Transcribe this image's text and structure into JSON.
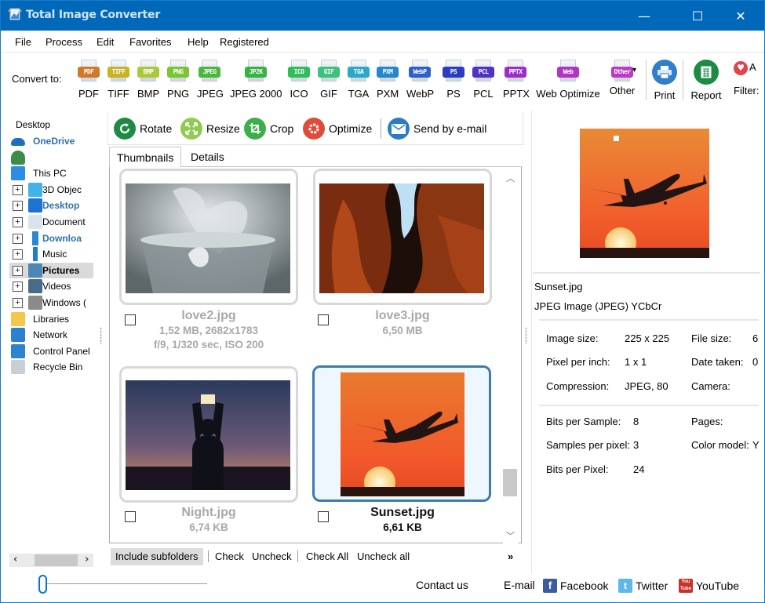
{
  "window": {
    "title": "Total Image Converter",
    "controls": {
      "minimize": "—",
      "maximize": "☐",
      "close": "✕"
    }
  },
  "menu": [
    "File",
    "Process",
    "Edit",
    "Favorites",
    "Help",
    "Registered"
  ],
  "toolbar": {
    "convert_label": "Convert to:",
    "formats": [
      {
        "badge": "PDF",
        "label": "PDF",
        "color": "#d2782a"
      },
      {
        "badge": "TIFF",
        "label": "TIFF",
        "color": "#c9b322"
      },
      {
        "badge": "BMP",
        "label": "BMP",
        "color": "#a9c83a"
      },
      {
        "badge": "PNG",
        "label": "PNG",
        "color": "#79c536"
      },
      {
        "badge": "JPEG",
        "label": "JPEG",
        "color": "#4bb73a"
      },
      {
        "badge": "JP2K",
        "label": "JPEG 2000",
        "color": "#36b341"
      },
      {
        "badge": "ICO",
        "label": "ICO",
        "color": "#2fbd5a"
      },
      {
        "badge": "GIF",
        "label": "GIF",
        "color": "#3ac27e"
      },
      {
        "badge": "TGA",
        "label": "TGA",
        "color": "#2aa8c6"
      },
      {
        "badge": "PXM",
        "label": "PXM",
        "color": "#2386cf"
      },
      {
        "badge": "WebP",
        "label": "WebP",
        "color": "#2f5fc7"
      },
      {
        "badge": "PS",
        "label": "PS",
        "color": "#2b3bc2"
      },
      {
        "badge": "PCL",
        "label": "PCL",
        "color": "#4f33c4"
      },
      {
        "badge": "PPTX",
        "label": "PPTX",
        "color": "#9b2fc6"
      },
      {
        "badge": "Web",
        "label": "Web Optimize",
        "color": "#b035c2"
      },
      {
        "badge": "Other",
        "label": "Other",
        "color": "#b93cc4"
      }
    ],
    "print_label": "Print",
    "report_label": "Report",
    "filter_label": "Filter:",
    "favorite_label": "A"
  },
  "tree": {
    "root": "Desktop",
    "items": [
      {
        "label": "OneDrive",
        "icon": "onedrive-icon",
        "style": "blue"
      },
      {
        "label": "",
        "icon": "user-icon",
        "style": "normal"
      },
      {
        "label": "This PC",
        "icon": "computer-icon",
        "style": "normal"
      },
      {
        "label": "3D Objec",
        "icon": "3d-objects-icon",
        "style": "normal",
        "expandable": true
      },
      {
        "label": "Desktop",
        "icon": "desktop-icon",
        "style": "blue",
        "expandable": true
      },
      {
        "label": "Document",
        "icon": "documents-icon",
        "style": "normal",
        "expandable": true
      },
      {
        "label": "Downloa",
        "icon": "downloads-icon",
        "style": "blue",
        "expandable": true
      },
      {
        "label": "Music",
        "icon": "music-icon",
        "style": "normal",
        "expandable": true
      },
      {
        "label": "Pictures",
        "icon": "pictures-icon",
        "style": "bold",
        "expandable": true,
        "selected": true
      },
      {
        "label": "Videos",
        "icon": "videos-icon",
        "style": "normal",
        "expandable": true
      },
      {
        "label": "Windows (",
        "icon": "drive-icon",
        "style": "normal",
        "expandable": true
      },
      {
        "label": "Libraries",
        "icon": "libraries-icon",
        "style": "normal"
      },
      {
        "label": "Network",
        "icon": "network-icon",
        "style": "normal"
      },
      {
        "label": "Control Panel",
        "icon": "control-panel-icon",
        "style": "normal"
      },
      {
        "label": "Recycle Bin",
        "icon": "recycle-bin-icon",
        "style": "normal"
      }
    ]
  },
  "actions": {
    "rotate": "Rotate",
    "resize": "Resize",
    "crop": "Crop",
    "optimize": "Optimize",
    "send_email": "Send by e-mail"
  },
  "tabs": {
    "thumbnails": "Thumbnails",
    "details": "Details"
  },
  "files": [
    {
      "name": "love2.jpg",
      "line1": "1,52 MB, 2682x1783",
      "line2": "f/9, 1/320 sec, ISO 200",
      "selected": false
    },
    {
      "name": "love3.jpg",
      "line1": "6,50 MB",
      "line2": "",
      "selected": false
    },
    {
      "name": "Night.jpg",
      "line1": "6,74 KB",
      "line2": "",
      "selected": false
    },
    {
      "name": "Sunset.jpg",
      "line1": "6,61 KB",
      "line2": "",
      "selected": true
    }
  ],
  "bottom_bar": {
    "include_subfolders": "Include subfolders",
    "check": "Check",
    "uncheck": "Uncheck",
    "check_all": "Check All",
    "uncheck_all": "Uncheck all",
    "more": "»"
  },
  "info": {
    "filename": "Sunset.jpg",
    "type": "JPEG Image (JPEG) YCbCr",
    "left_rows": [
      {
        "label": "Image size:",
        "value": "225 x 225"
      },
      {
        "label": "Pixel per inch:",
        "value": "1 x 1"
      },
      {
        "label": "Compression:",
        "value": "JPEG, 80"
      }
    ],
    "right_rows": [
      {
        "label": "File size:",
        "value": "6"
      },
      {
        "label": "Date taken:",
        "value": "0"
      },
      {
        "label": "Camera:",
        "value": ""
      }
    ],
    "left_rows2": [
      {
        "label": "Bits per Sample:",
        "value": "8"
      },
      {
        "label": "Samples per pixel:",
        "value": "3"
      },
      {
        "label": "Bits per Pixel:",
        "value": "24"
      }
    ],
    "right_rows2": [
      {
        "label": "Pages:",
        "value": ""
      },
      {
        "label": "Color model:",
        "value": "Y"
      }
    ]
  },
  "footer": {
    "contact": "Contact us",
    "email": "E-mail",
    "facebook": "Facebook",
    "twitter": "Twitter",
    "youtube": "YouTube"
  },
  "zoom_slider": {
    "value_fraction": 0.0
  }
}
